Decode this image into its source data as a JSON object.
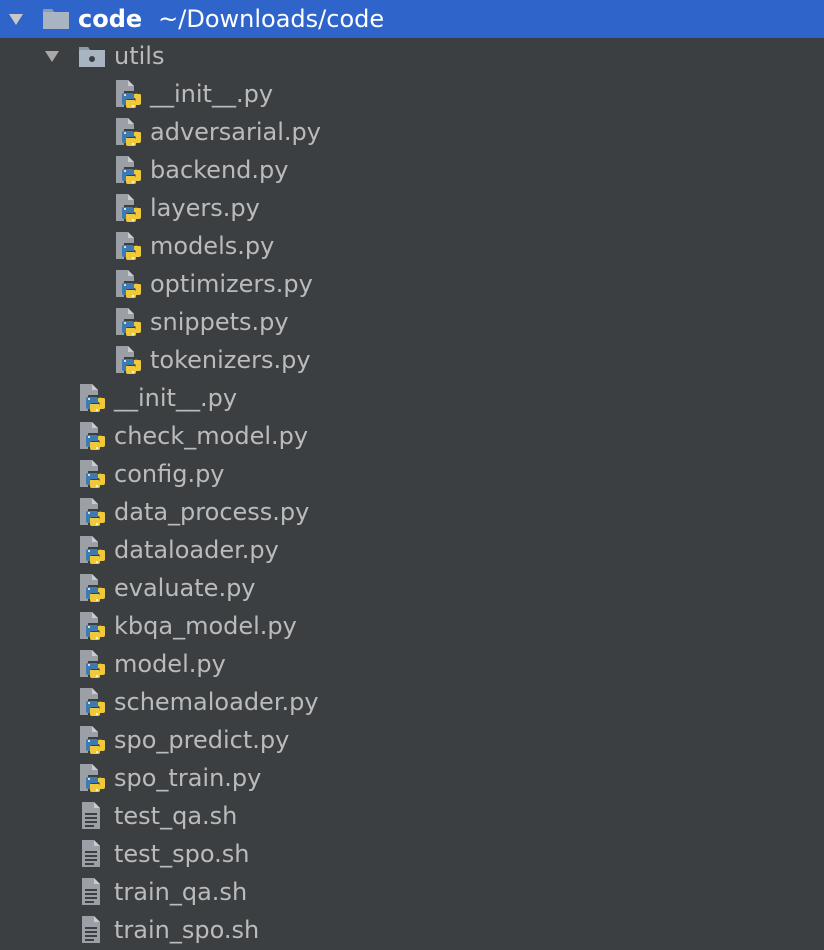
{
  "root": {
    "name": "code",
    "path": "~/Downloads/code",
    "icon": "folder-icon",
    "expanded": true
  },
  "utils": {
    "name": "utils",
    "icon": "package-folder-icon",
    "expanded": true,
    "files": [
      {
        "name": "__init__.py",
        "icon": "python-file-icon"
      },
      {
        "name": "adversarial.py",
        "icon": "python-file-icon"
      },
      {
        "name": "backend.py",
        "icon": "python-file-icon"
      },
      {
        "name": "layers.py",
        "icon": "python-file-icon"
      },
      {
        "name": "models.py",
        "icon": "python-file-icon"
      },
      {
        "name": "optimizers.py",
        "icon": "python-file-icon"
      },
      {
        "name": "snippets.py",
        "icon": "python-file-icon"
      },
      {
        "name": "tokenizers.py",
        "icon": "python-file-icon"
      }
    ]
  },
  "files": [
    {
      "name": "__init__.py",
      "icon": "python-file-icon"
    },
    {
      "name": "check_model.py",
      "icon": "python-file-icon"
    },
    {
      "name": "config.py",
      "icon": "python-file-icon"
    },
    {
      "name": "data_process.py",
      "icon": "python-file-icon"
    },
    {
      "name": "dataloader.py",
      "icon": "python-file-icon"
    },
    {
      "name": "evaluate.py",
      "icon": "python-file-icon"
    },
    {
      "name": "kbqa_model.py",
      "icon": "python-file-icon"
    },
    {
      "name": "model.py",
      "icon": "python-file-icon"
    },
    {
      "name": "schemaloader.py",
      "icon": "python-file-icon"
    },
    {
      "name": "spo_predict.py",
      "icon": "python-file-icon"
    },
    {
      "name": "spo_train.py",
      "icon": "python-file-icon"
    },
    {
      "name": "test_qa.sh",
      "icon": "text-file-icon"
    },
    {
      "name": "test_spo.sh",
      "icon": "text-file-icon"
    },
    {
      "name": "train_qa.sh",
      "icon": "text-file-icon"
    },
    {
      "name": "train_spo.sh",
      "icon": "text-file-icon"
    }
  ],
  "colors": {
    "background": "#3c3f41",
    "selection": "#2f65ca",
    "text": "#bbbbbb",
    "python_blue": "#3d7ab3",
    "python_yellow": "#f0c93a",
    "file_gray": "#9aa0a6"
  }
}
